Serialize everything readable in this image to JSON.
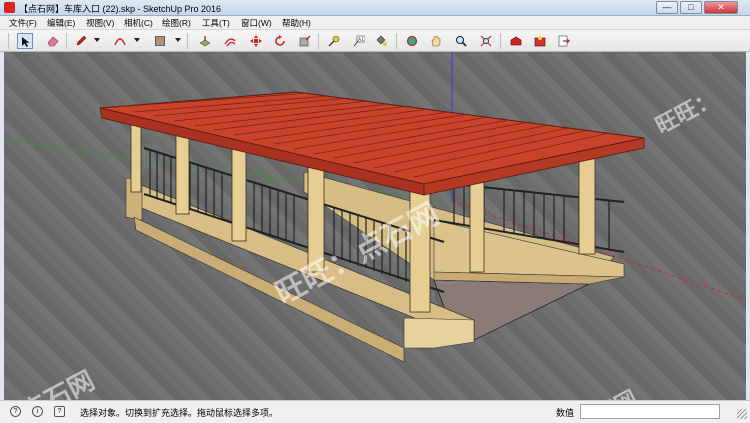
{
  "window": {
    "title": "【点石网】车库入口 (22).skp - SketchUp Pro 2016",
    "minimize": "—",
    "maximize": "□",
    "close": "✕"
  },
  "menu": [
    {
      "label": "文件(F)"
    },
    {
      "label": "编辑(E)"
    },
    {
      "label": "视图(V)"
    },
    {
      "label": "相机(C)"
    },
    {
      "label": "绘图(R)"
    },
    {
      "label": "工具(T)"
    },
    {
      "label": "窗口(W)"
    },
    {
      "label": "帮助(H)"
    }
  ],
  "toolbar": [
    {
      "name": "select-tool",
      "icon": "arrow-cursor-icon"
    },
    {
      "name": "eraser-tool",
      "icon": "eraser-icon"
    },
    {
      "name": "pencil-tool",
      "icon": "pencil-icon"
    },
    {
      "name": "arc-tool",
      "icon": "arc-icon"
    },
    {
      "name": "rectangle-tool",
      "icon": "rectangle-icon"
    },
    {
      "name": "push-pull-tool",
      "icon": "push-pull-icon"
    },
    {
      "name": "offset-tool",
      "icon": "offset-icon"
    },
    {
      "name": "move-tool",
      "icon": "move-icon"
    },
    {
      "name": "rotate-tool",
      "icon": "rotate-icon"
    },
    {
      "name": "scale-tool",
      "icon": "scale-icon"
    },
    {
      "name": "tape-measure-tool",
      "icon": "tape-measure-icon"
    },
    {
      "name": "text-tool",
      "icon": "text-label-icon"
    },
    {
      "name": "paint-bucket-tool",
      "icon": "paint-bucket-icon"
    },
    {
      "name": "orbit-tool",
      "icon": "orbit-icon"
    },
    {
      "name": "pan-tool",
      "icon": "hand-icon"
    },
    {
      "name": "zoom-tool",
      "icon": "magnifier-icon"
    },
    {
      "name": "zoom-extents-tool",
      "icon": "zoom-extents-icon"
    },
    {
      "name": "warehouse-tool",
      "icon": "warehouse-icon"
    },
    {
      "name": "extension-warehouse-tool",
      "icon": "extension-icon"
    },
    {
      "name": "send-to-layout-tool",
      "icon": "layout-icon"
    }
  ],
  "watermarks": [
    "旺旺：点石网",
    "旺旺：点石网",
    "旺旺：",
    "点石网",
    "点石网"
  ],
  "status": {
    "message": "选择对象。切换到扩充选择。拖动鼠标选择多项。",
    "vcb_label": "数值",
    "vcb_value": ""
  },
  "colors": {
    "roof": "#c8432a",
    "stone": "#e3c98d",
    "railing": "#2b2f35",
    "ground": "#6e6e6e"
  }
}
